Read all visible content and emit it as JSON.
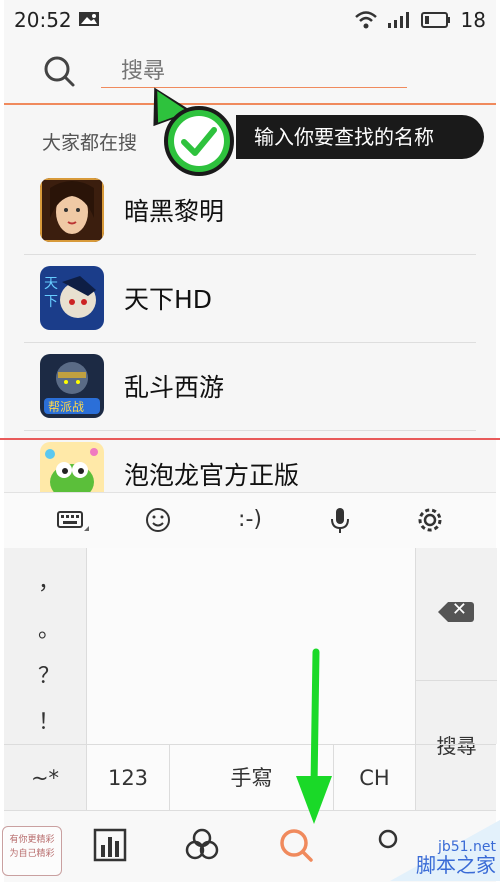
{
  "statusbar": {
    "time": "20:52",
    "battery_level": "18"
  },
  "search": {
    "placeholder": "搜尋"
  },
  "callout": {
    "text": "输入你要查找的名称"
  },
  "section_title": "大家都在搜",
  "apps": [
    {
      "name": "暗黑黎明"
    },
    {
      "name": "天下HD"
    },
    {
      "name": "乱斗西游"
    },
    {
      "name": "泡泡龙官方正版"
    }
  ],
  "keyboard": {
    "toolbar": {
      "emoticon": ":-)"
    },
    "punctuation": [
      "，",
      "。",
      "？",
      "！"
    ],
    "bottom_row": [
      "~*",
      "123",
      "手寫",
      "CH"
    ],
    "search_key": "搜尋"
  },
  "watermark": {
    "left_line1": "有你更精彩",
    "left_line2": "为自己精彩",
    "site": "jb51.net",
    "name": "脚本之家"
  },
  "colors": {
    "accent": "#f08a5d",
    "callout_green": "#2ec23d",
    "arrow_green": "#1ad928"
  }
}
